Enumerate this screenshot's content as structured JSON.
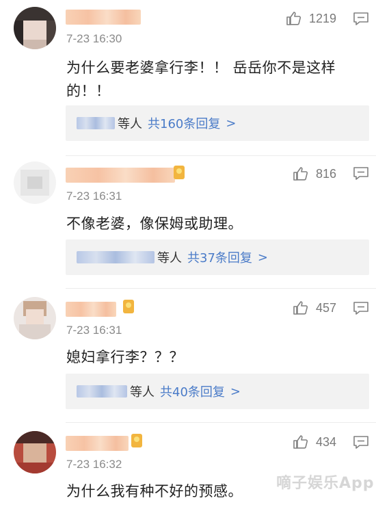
{
  "comments": [
    {
      "time": "7-23 16:30",
      "text": "为什么要老婆拿行李！！ 岳岳你不是这样的！！",
      "likes": "1219",
      "replies": {
        "suffix": "等人",
        "count_text": "共160条回复",
        "chevron": ">"
      }
    },
    {
      "time": "7-23 16:31",
      "text": "不像老婆，像保姆或助理。",
      "likes": "816",
      "replies": {
        "suffix": "等人",
        "count_text": "共37条回复",
        "chevron": ">"
      }
    },
    {
      "time": "7-23 16:31",
      "text": "媳妇拿行李？？？",
      "likes": "457",
      "replies": {
        "suffix": "等人",
        "count_text": "共40条回复",
        "chevron": ">"
      }
    },
    {
      "time": "7-23 16:32",
      "text": "为什么我有种不好的预感。",
      "likes": "434"
    }
  ],
  "watermark": "嘀子娱乐App",
  "colors": {
    "link": "#4a7bc8",
    "meta": "#8a8a8a",
    "reply_bg": "#f2f2f2"
  },
  "icons": [
    "thumbs-up-icon",
    "comment-reply-icon",
    "vip-badge-icon"
  ]
}
